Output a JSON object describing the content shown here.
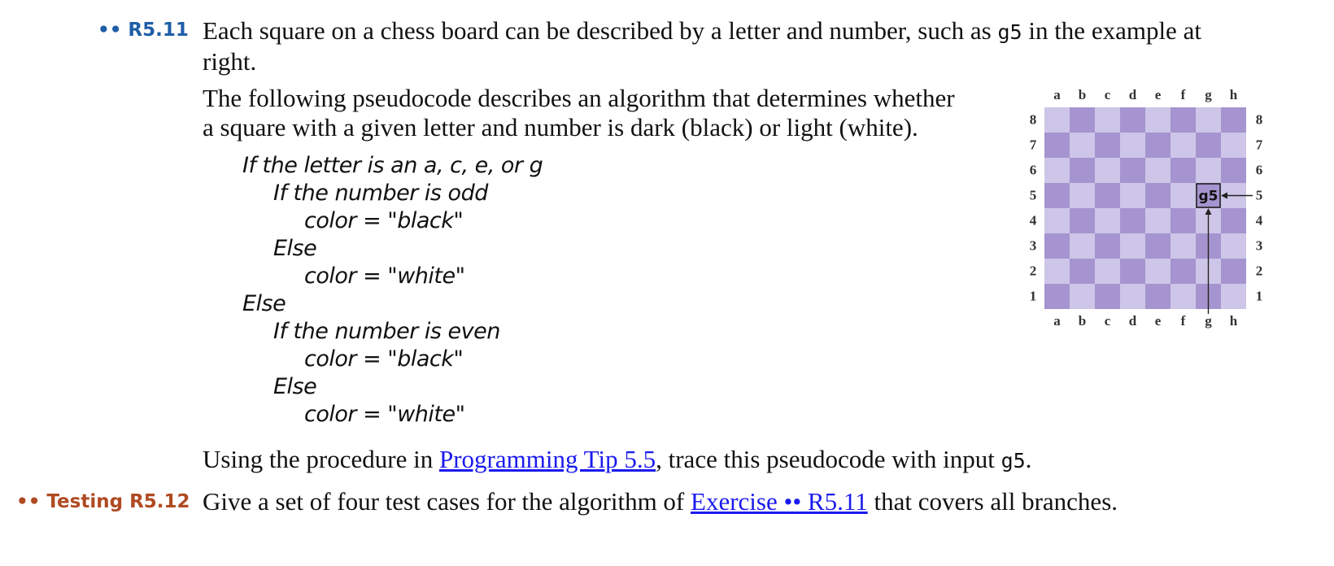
{
  "exercise_r511": {
    "dots": "••",
    "id": "R5.11",
    "intro_part1": "Each square on a chess board can be described by a letter and number, such as ",
    "intro_code": "g5",
    "intro_part2_line1": " in the example at",
    "intro_part2_line2": "right.",
    "description_line1": "The following pseudocode describes an algorithm that determines whether",
    "description_line2": "a square with a given letter and number is dark (black) or light (white).",
    "pseudocode": [
      "If the letter is an a, c, e, or g",
      "If the number is odd",
      "color = \"black\"",
      "Else",
      "color = \"white\"",
      "Else",
      "If the number is even",
      "color = \"black\"",
      "Else",
      "color = \"white\""
    ],
    "trace_part1": "Using the procedure in ",
    "trace_link": "Programming Tip 5.5",
    "trace_part2": ", trace this pseudocode with input ",
    "trace_code": "g5",
    "trace_end": "."
  },
  "exercise_r512": {
    "dots": "••",
    "category": "Testing",
    "id": "R5.12",
    "text_part1": "Give a set of four test cases for the algorithm of ",
    "link": "Exercise •• R5.11",
    "text_part2": " that covers all branches."
  },
  "chessboard": {
    "files": [
      "a",
      "b",
      "c",
      "d",
      "e",
      "f",
      "g",
      "h"
    ],
    "ranks": [
      "8",
      "7",
      "6",
      "5",
      "4",
      "3",
      "2",
      "1"
    ],
    "highlight_label": "g5",
    "light_color": "#cdc6e8",
    "dark_color": "#a594cf"
  }
}
